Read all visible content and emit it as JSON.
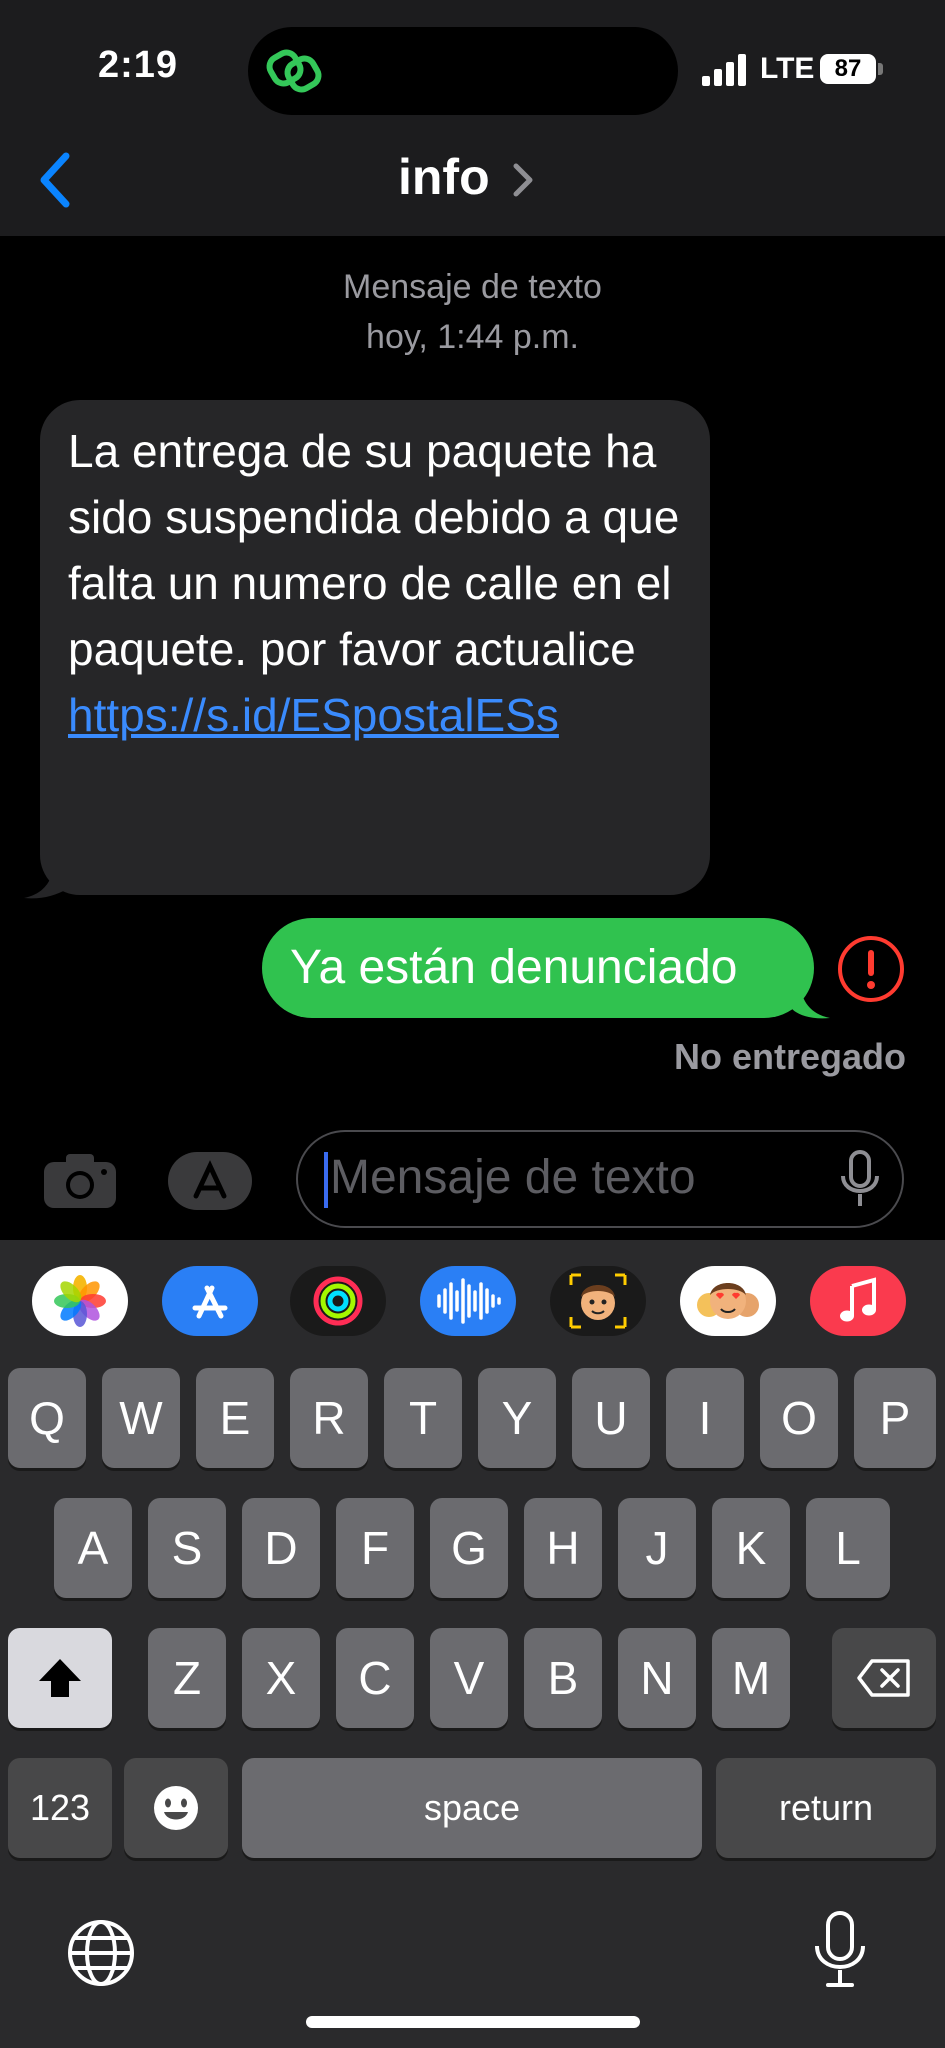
{
  "status_bar": {
    "time": "2:19",
    "network": "LTE",
    "battery": "87"
  },
  "nav": {
    "contact_name": "info"
  },
  "conversation": {
    "meta_line1": "Mensaje de texto",
    "meta_line2": "hoy, 1:44 p.m.",
    "incoming_text": "La entrega de su paquete ha sido suspendida debido a que falta un numero de calle en el paquete. por favor actualice ",
    "incoming_link": "https://s.id/ESpostalESs",
    "outgoing_text": "Ya están denunciado",
    "delivery_status": "No entregado"
  },
  "composer": {
    "placeholder": "Mensaje de texto"
  },
  "app_drawer": [
    "photos-icon",
    "app-store-icon",
    "activity-icon",
    "audio-message-icon",
    "memoji-icon",
    "memoji-stickers-icon",
    "music-icon"
  ],
  "keyboard": {
    "row1": [
      "Q",
      "W",
      "E",
      "R",
      "T",
      "Y",
      "U",
      "I",
      "O",
      "P"
    ],
    "row2": [
      "A",
      "S",
      "D",
      "F",
      "G",
      "H",
      "J",
      "K",
      "L"
    ],
    "row3": [
      "Z",
      "X",
      "C",
      "V",
      "B",
      "N",
      "M"
    ],
    "numbers_label": "123",
    "space_label": "space",
    "return_label": "return"
  },
  "colors": {
    "outgoing_bubble": "#30c24f",
    "link": "#3a8bfd",
    "error": "#ff3b30",
    "accent": "#0a84ff"
  }
}
